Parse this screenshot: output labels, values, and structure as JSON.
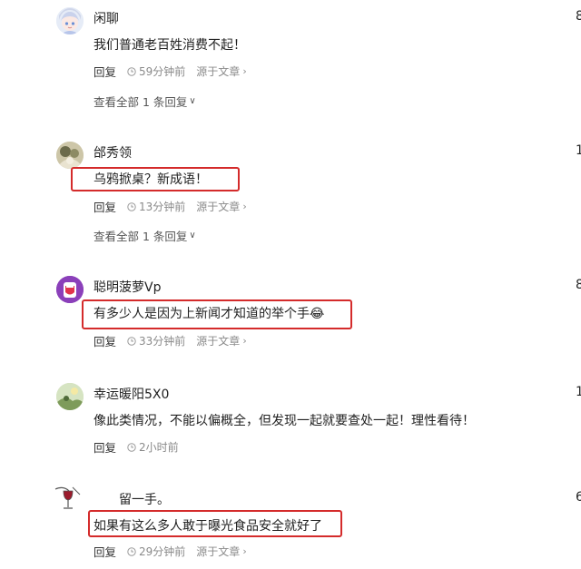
{
  "comments": [
    {
      "username": "闲聊",
      "text": "我们普通老百姓消费不起！",
      "reply_label": "回复",
      "time": "59分钟前",
      "source_label": "源于文章",
      "view_all": "查看全部 1 条回复",
      "edge_count": "8"
    },
    {
      "username": "邰秀领",
      "text": "乌鸦掀桌？新成语！",
      "reply_label": "回复",
      "time": "13分钟前",
      "source_label": "源于文章",
      "view_all": "查看全部 1 条回复",
      "edge_count": "1"
    },
    {
      "username": "聪明菠萝Vp",
      "text": "有多少人是因为上新闻才知道的举个手😂",
      "reply_label": "回复",
      "time": "33分钟前",
      "source_label": "源于文章",
      "edge_count": "8"
    },
    {
      "username": "幸运暖阳5X0",
      "text": "像此类情况，不能以偏概全，但发现一起就要查处一起！理性看待！",
      "reply_label": "回复",
      "time": "2小时前",
      "edge_count": "1"
    },
    {
      "username": "留一手。",
      "text": "如果有这么多人敢于曝光食品安全就好了",
      "reply_label": "回复",
      "time": "29分钟前",
      "source_label": "源于文章",
      "edge_count": "6"
    }
  ],
  "colors": {
    "highlight_box": "#d42b2b",
    "meta_text": "#8a8a8a"
  }
}
